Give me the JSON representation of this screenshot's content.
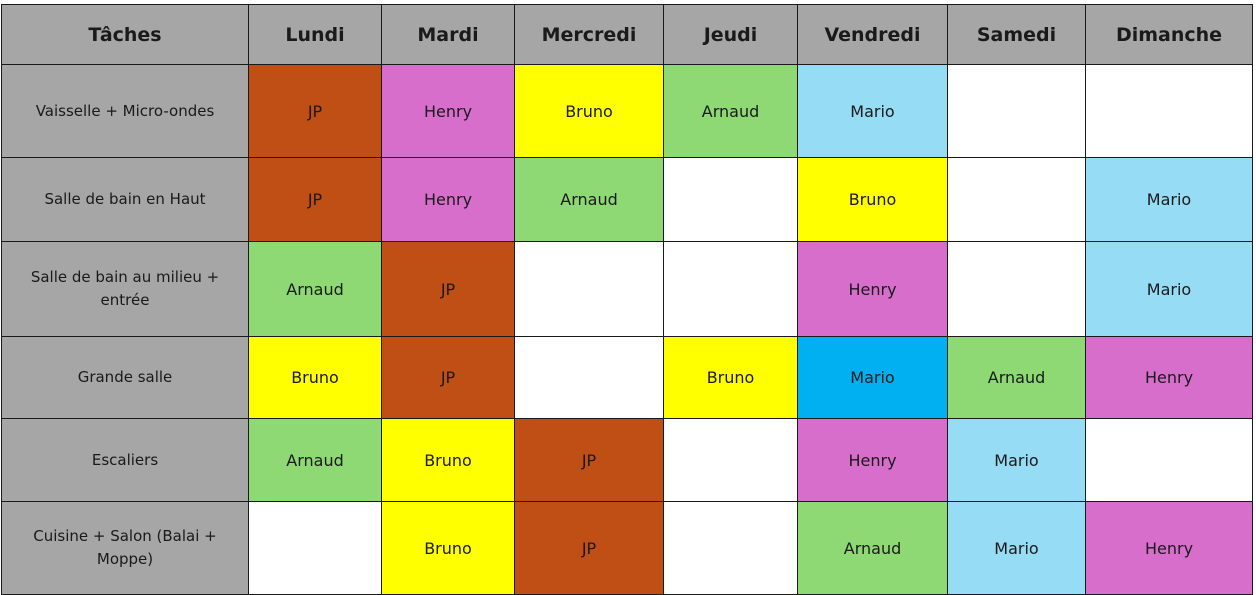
{
  "colors": {
    "header_bg": "#a6a6a6",
    "task_bg": "#a6a6a6",
    "empty": "#ffffff",
    "JP": "#c04f15",
    "Henry": "#d86ecc",
    "Bruno": "#ffff00",
    "Arnaud": "#8ed973",
    "Mario": "#97dcf5",
    "Mario_strong": "#00b0f0"
  },
  "table": {
    "headers": [
      "Tâches",
      "Lundi",
      "Mardi",
      "Mercredi",
      "Jeudi",
      "Vendredi",
      "Samedi",
      "Dimanche"
    ],
    "rows": [
      {
        "task": "Vaisselle + Micro-ondes",
        "cells": [
          "JP",
          "Henry",
          "Bruno",
          "Arnaud",
          "Mario",
          "",
          ""
        ],
        "fills": [
          "JP",
          "Henry",
          "Bruno",
          "Arnaud",
          "Mario",
          "empty",
          "empty"
        ]
      },
      {
        "task": "Salle de bain en Haut",
        "cells": [
          "JP",
          "Henry",
          "Arnaud",
          "",
          "Bruno",
          "",
          "Mario"
        ],
        "fills": [
          "JP",
          "Henry",
          "Arnaud",
          "empty",
          "Bruno",
          "empty",
          "Mario"
        ]
      },
      {
        "task": "Salle de bain au milieu + entrée",
        "cells": [
          "Arnaud",
          "JP",
          "",
          "",
          "Henry",
          "",
          "Mario"
        ],
        "fills": [
          "Arnaud",
          "JP",
          "empty",
          "empty",
          "Henry",
          "empty",
          "Mario"
        ]
      },
      {
        "task": "Grande salle",
        "cells": [
          "Bruno",
          "JP",
          "",
          "Bruno",
          "Mario",
          "Arnaud",
          "Henry"
        ],
        "fills": [
          "Bruno",
          "JP",
          "empty",
          "Bruno",
          "Mario_strong",
          "Arnaud",
          "Henry"
        ]
      },
      {
        "task": "Escaliers",
        "cells": [
          "Arnaud",
          "Bruno",
          "JP",
          "",
          "Henry",
          "Mario",
          ""
        ],
        "fills": [
          "Arnaud",
          "Bruno",
          "JP",
          "empty",
          "Henry",
          "Mario",
          "empty"
        ]
      },
      {
        "task": "Cuisine + Salon (Balai + Moppe)",
        "cells": [
          "",
          "Bruno",
          "JP",
          "",
          "Arnaud",
          "Mario",
          "Henry"
        ],
        "fills": [
          "empty",
          "Bruno",
          "JP",
          "empty",
          "Arnaud",
          "Mario",
          "Henry"
        ]
      }
    ]
  }
}
